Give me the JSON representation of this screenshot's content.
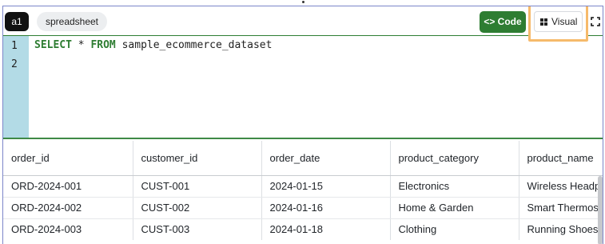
{
  "header": {
    "cell_id": "a1",
    "cell_type": "spreadsheet",
    "code_label": "Code",
    "code_icon_text": "<>",
    "visual_label": "Visual"
  },
  "editor": {
    "line_numbers": [
      "1",
      "2"
    ],
    "query": {
      "kw_select": "SELECT",
      "star": " * ",
      "kw_from": "FROM",
      "table": " sample_ecommerce_dataset"
    }
  },
  "table": {
    "columns": [
      "order_id",
      "customer_id",
      "order_date",
      "product_category",
      "product_name"
    ],
    "rows": [
      [
        "ORD-2024-001",
        "CUST-001",
        "2024-01-15",
        "Electronics",
        "Wireless Headphones"
      ],
      [
        "ORD-2024-002",
        "CUST-002",
        "2024-01-16",
        "Home & Garden",
        "Smart Thermostat"
      ],
      [
        "ORD-2024-003",
        "CUST-003",
        "2024-01-18",
        "Clothing",
        "Running Shoes"
      ]
    ]
  },
  "colors": {
    "accent_green": "#2e7d32",
    "gutter": "#b3dbe6",
    "highlight": "#f6ba6b"
  }
}
